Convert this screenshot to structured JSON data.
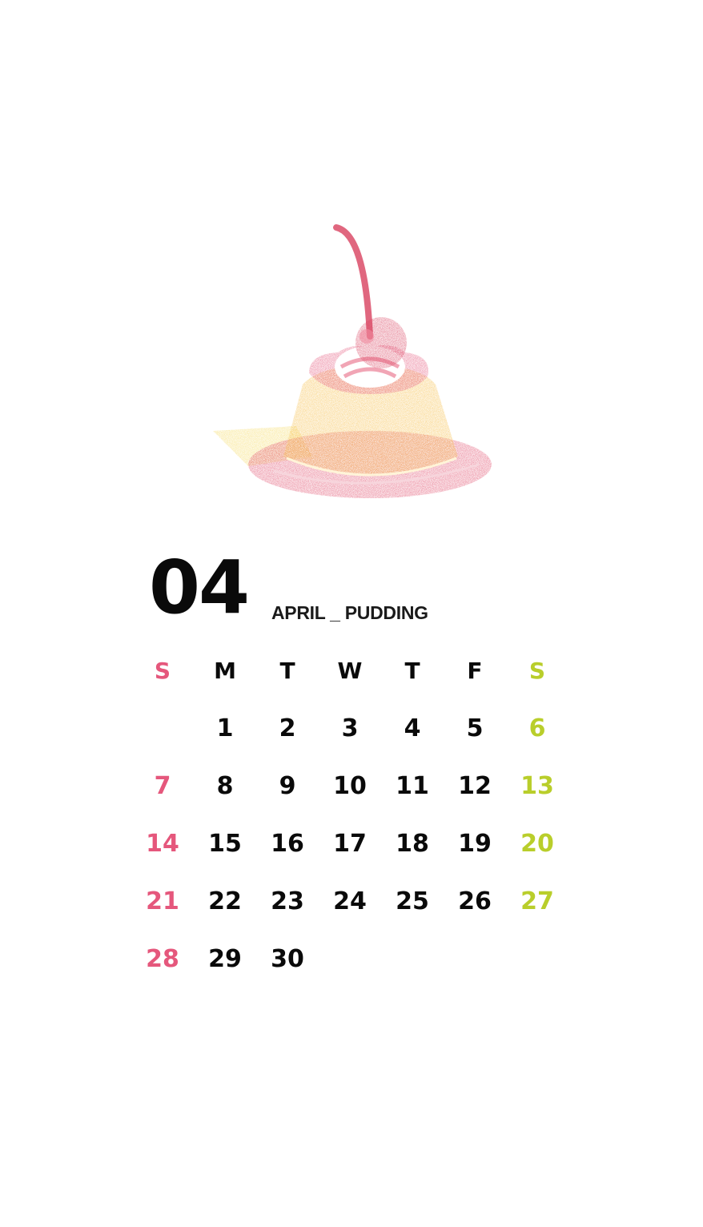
{
  "month_number": "04",
  "month_caption": "APRIL _ PUDDING",
  "colors": {
    "sunday": "#e5577c",
    "saturday": "#b9ce2b",
    "text": "#0a0a0a",
    "pudding": "#f6bd45",
    "plate": "#e04b6a",
    "cherry": "#d9425f"
  },
  "weekdays": [
    "S",
    "M",
    "T",
    "W",
    "T",
    "F",
    "S"
  ],
  "weeks": [
    [
      "",
      "1",
      "2",
      "3",
      "4",
      "5",
      "6"
    ],
    [
      "7",
      "8",
      "9",
      "10",
      "11",
      "12",
      "13"
    ],
    [
      "14",
      "15",
      "16",
      "17",
      "18",
      "19",
      "20"
    ],
    [
      "21",
      "22",
      "23",
      "24",
      "25",
      "26",
      "27"
    ],
    [
      "28",
      "29",
      "30",
      "",
      "",
      "",
      ""
    ]
  ]
}
